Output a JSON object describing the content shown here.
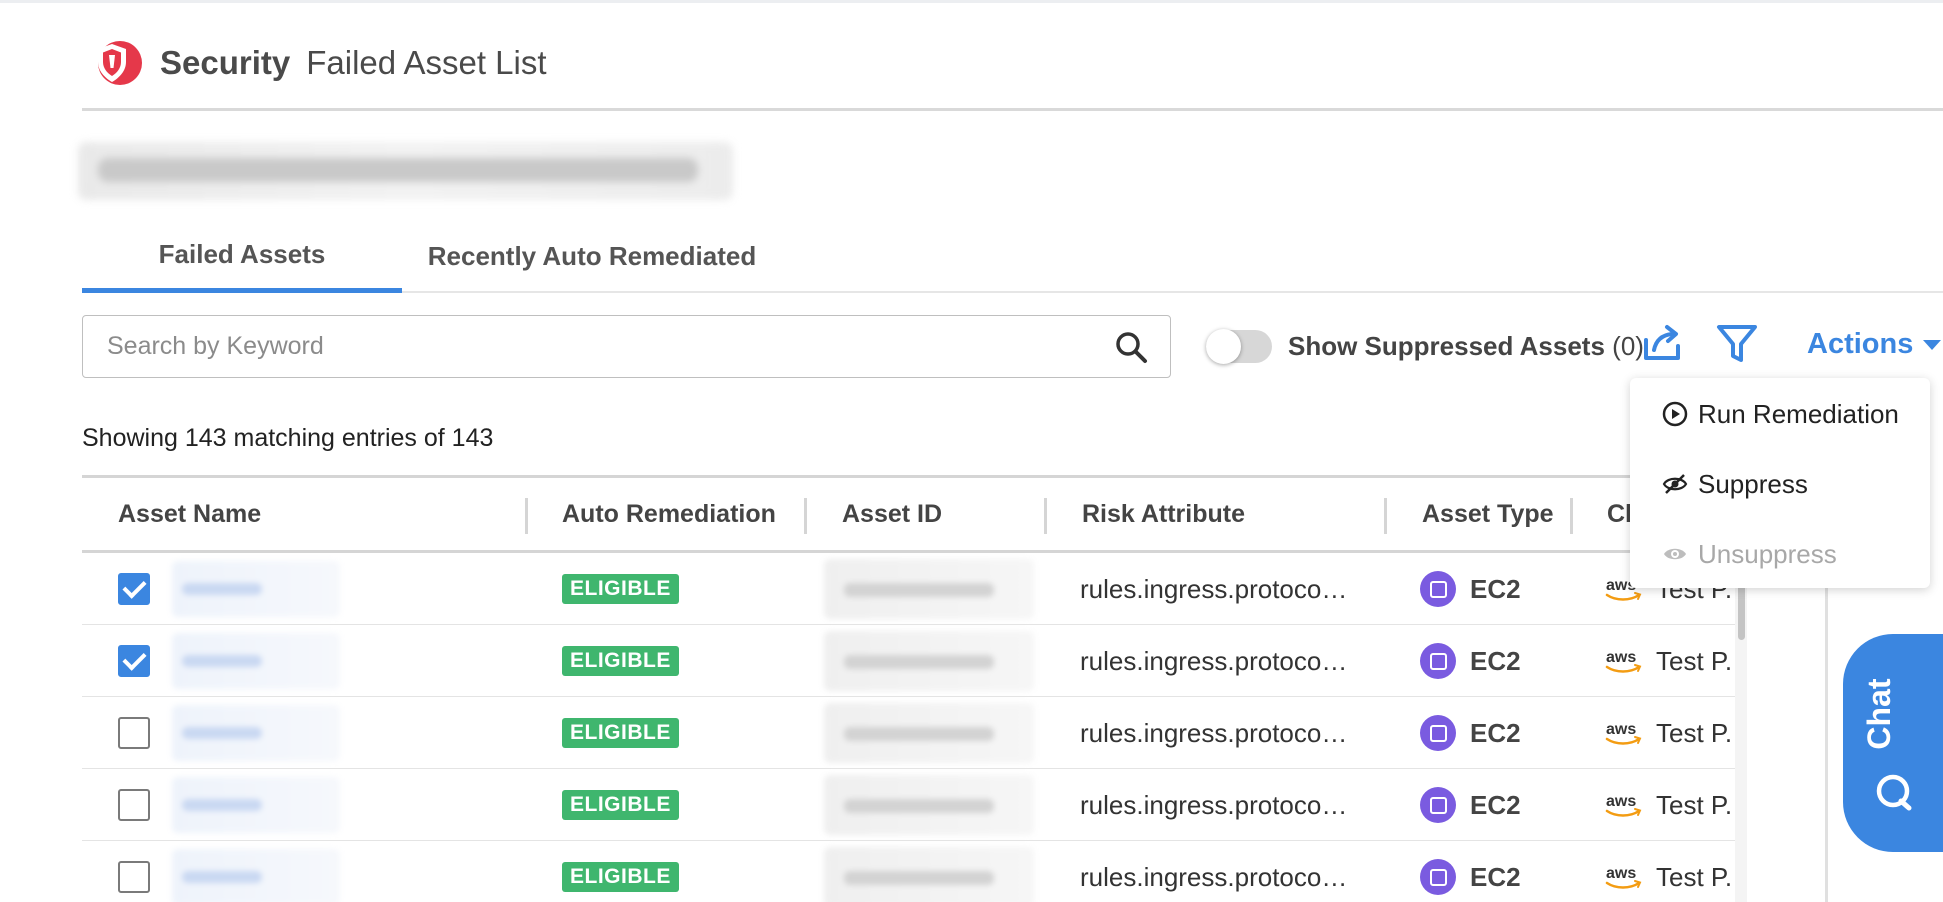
{
  "header": {
    "brand": "Security",
    "page_title": "Failed Asset List"
  },
  "tabs": [
    {
      "label": "Failed Assets",
      "active": true
    },
    {
      "label": "Recently Auto Remediated",
      "active": false
    }
  ],
  "toolbar": {
    "search_placeholder": "Search by Keyword",
    "toggle_label": "Show Suppressed Assets",
    "toggle_count": "(0)",
    "toggle_on": false,
    "actions_label": "Actions"
  },
  "summary": "Showing 143 matching entries of 143",
  "table": {
    "columns": [
      "Asset Name",
      "Auto Remediation",
      "Asset ID",
      "Risk Attribute",
      "Asset Type",
      "Cl"
    ],
    "rows": [
      {
        "checked": true,
        "auto_remediation": "ELIGIBLE",
        "risk_attribute": "rules.ingress.protoco…",
        "asset_type": "EC2",
        "cloud": "Test P."
      },
      {
        "checked": true,
        "auto_remediation": "ELIGIBLE",
        "risk_attribute": "rules.ingress.protoco…",
        "asset_type": "EC2",
        "cloud": "Test P."
      },
      {
        "checked": false,
        "auto_remediation": "ELIGIBLE",
        "risk_attribute": "rules.ingress.protoco…",
        "asset_type": "EC2",
        "cloud": "Test P."
      },
      {
        "checked": false,
        "auto_remediation": "ELIGIBLE",
        "risk_attribute": "rules.ingress.protoco…",
        "asset_type": "EC2",
        "cloud": "Test P."
      },
      {
        "checked": false,
        "auto_remediation": "ELIGIBLE",
        "risk_attribute": "rules.ingress.protoco…",
        "asset_type": "EC2",
        "cloud": "Test P."
      }
    ]
  },
  "actions_menu": {
    "items": [
      {
        "label": "Run Remediation",
        "icon": "play-circle-icon",
        "disabled": false
      },
      {
        "label": "Suppress",
        "icon": "eye-slash-icon",
        "disabled": false
      },
      {
        "label": "Unsuppress",
        "icon": "eye-icon",
        "disabled": true
      }
    ]
  },
  "chat": {
    "label": "Chat"
  },
  "colors": {
    "accent": "#3b86e0",
    "brand_red": "#e5384a",
    "eligible_green": "#3fb66e",
    "ec2_purple": "#7a5be0"
  }
}
